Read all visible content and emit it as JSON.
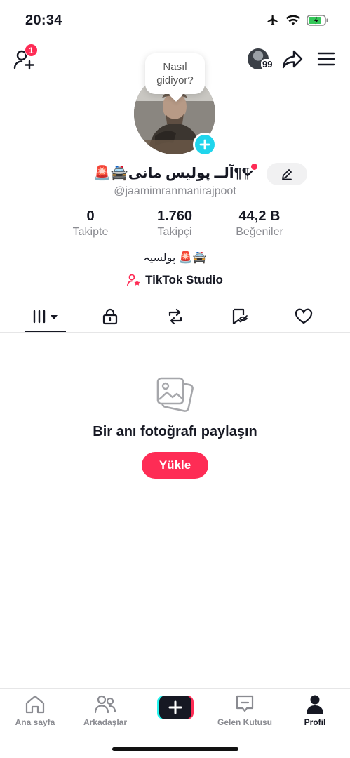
{
  "status_bar": {
    "time": "20:34"
  },
  "header": {
    "notification_count": "1",
    "story_count": "99"
  },
  "profile": {
    "bubble_text": "Nasıl gidiyor?",
    "display_name": "🚨🚔آلــ پولیس مانی¶¶",
    "username": "@jaamimranmanirajpoot",
    "bio": "پولسیہ 🚨🚔",
    "studio_label": "TikTok Studio"
  },
  "stats": [
    {
      "value": "0",
      "label": "Takipte"
    },
    {
      "value": "1.760",
      "label": "Takipçi"
    },
    {
      "value": "44,2 B",
      "label": "Beğeniler"
    }
  ],
  "tabs": [
    "videos-tab",
    "private-tab",
    "reposts-tab",
    "favorites-tab",
    "liked-tab"
  ],
  "empty_state": {
    "title": "Bir anı fotoğrafı paylaşın",
    "button": "Yükle"
  },
  "bottom_nav": [
    {
      "label": "Ana sayfa",
      "icon": "home-icon"
    },
    {
      "label": "Arkadaşlar",
      "icon": "friends-icon"
    },
    {
      "label": "",
      "icon": "create-icon"
    },
    {
      "label": "Gelen Kutusu",
      "icon": "inbox-icon"
    },
    {
      "label": "Profil",
      "icon": "profile-icon"
    }
  ],
  "colors": {
    "accent": "#fe2c55",
    "cyan": "#20d5ec",
    "text": "#161823",
    "muted": "#8a8b91"
  }
}
